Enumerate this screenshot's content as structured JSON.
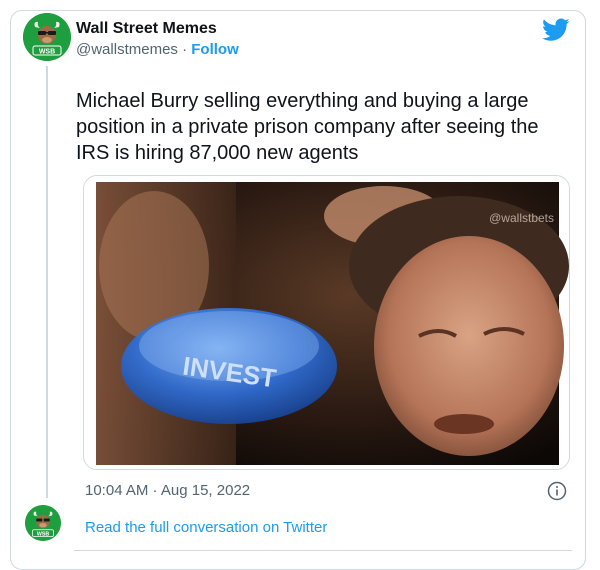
{
  "account": {
    "display_name": "Wall Street Memes",
    "handle": "@wallstmemes",
    "separator": "·",
    "follow_label": "Follow",
    "avatar_text": "WSB"
  },
  "tweet": {
    "text": "Michael Burry selling everything and buying a large position in a private prison company after seeing the IRS is hiring 87,000 new agents",
    "timestamp": "10:04 AM · Aug 15, 2022"
  },
  "media": {
    "button_text": "INVEST",
    "watermark": "@wallstbets"
  },
  "footer": {
    "read_full_label": "Read the full conversation on Twitter"
  },
  "colors": {
    "accent": "#1d9bf0",
    "avatar_bg": "#1f9e3f",
    "text_primary": "#0f1419",
    "text_secondary": "#536471",
    "border": "#cfd9de"
  },
  "icons": [
    "twitter-bird-icon",
    "info-icon",
    "bull-avatar-icon"
  ]
}
